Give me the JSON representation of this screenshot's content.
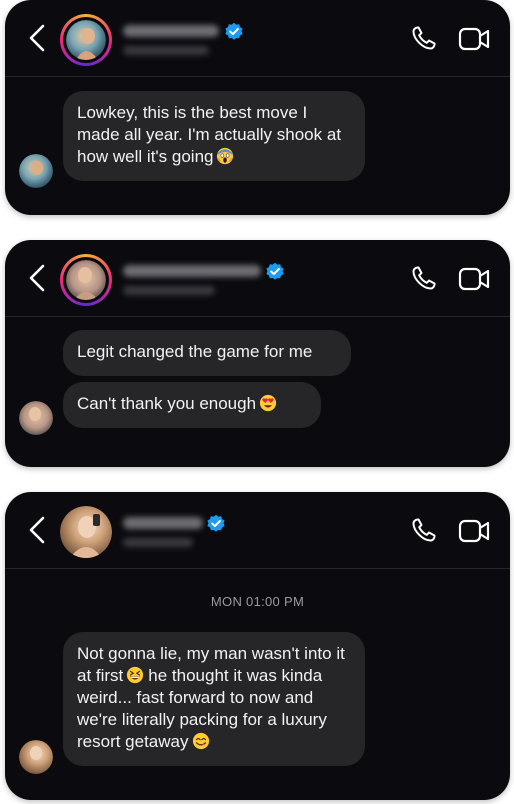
{
  "colors": {
    "card_bg": "#0b0b0f",
    "bubble_bg": "#262629",
    "text": "#f2f2f2",
    "verified": "#1d9bf0",
    "divider": "#26262b",
    "timestamp": "#9a9aa0"
  },
  "chats": [
    {
      "header": {
        "name_blurred": true,
        "verified": true,
        "icons": [
          "back-chevron-icon",
          "phone-icon",
          "video-camera-icon"
        ]
      },
      "messages": [
        {
          "text": "Lowkey, this is the best move I made all year. I'm actually shook at how well it's going",
          "emoji": "face-screaming-in-fear"
        }
      ]
    },
    {
      "header": {
        "name_blurred": true,
        "verified": true,
        "icons": [
          "back-chevron-icon",
          "phone-icon",
          "video-camera-icon"
        ]
      },
      "messages": [
        {
          "text": "Legit changed the game for me"
        },
        {
          "text": "Can't thank you enough",
          "emoji": "heart-eyes"
        }
      ]
    },
    {
      "header": {
        "name_blurred": true,
        "verified": true,
        "icons": [
          "back-chevron-icon",
          "phone-icon",
          "video-camera-icon"
        ]
      },
      "timestamp": "MON 01:00 PM",
      "messages": [
        {
          "text_a": "Not gonna lie, my man wasn't into it at first",
          "emoji_a": "grinning-squinting",
          "text_b": "he thought it was kinda weird... fast forward to now and we're literally packing for a luxury resort getaway",
          "emoji_b": "face-savoring-food"
        }
      ]
    }
  ]
}
